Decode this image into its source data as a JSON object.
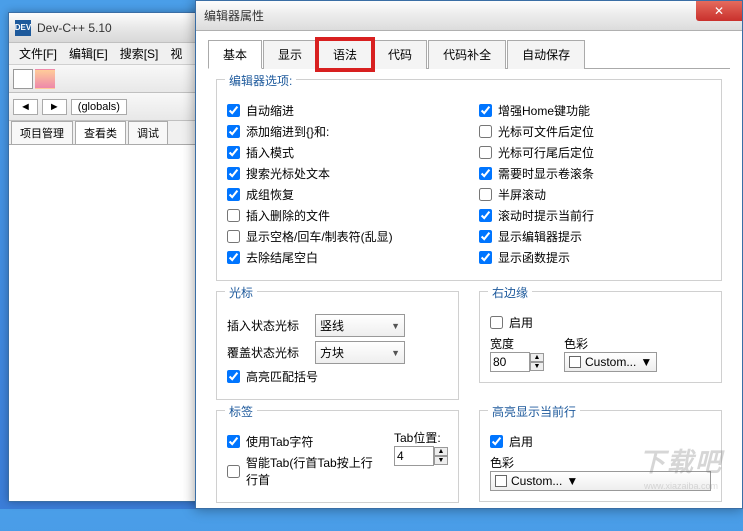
{
  "main": {
    "title": "Dev-C++ 5.10",
    "icon_text": "DEV",
    "menu": [
      "文件[F]",
      "编辑[E]",
      "搜索[S]",
      "视"
    ],
    "globals": "(globals)",
    "proj_tabs": [
      "项目管理",
      "查看类",
      "调试"
    ]
  },
  "dialog": {
    "title": "编辑器属性",
    "tabs": [
      "基本",
      "显示",
      "语法",
      "代码",
      "代码补全",
      "自动保存"
    ],
    "highlighted_tab_index": 2,
    "active_tab_index": 0,
    "editor_options_title": "编辑器选项:",
    "left_checks": [
      {
        "label": "自动缩进",
        "checked": true
      },
      {
        "label": "添加缩进到{}和:",
        "checked": true
      },
      {
        "label": "插入模式",
        "checked": true
      },
      {
        "label": "搜索光标处文本",
        "checked": true
      },
      {
        "label": "成组恢复",
        "checked": true
      },
      {
        "label": "插入删除的文件",
        "checked": false
      },
      {
        "label": "显示空格/回车/制表符(乱显)",
        "checked": false
      },
      {
        "label": "去除结尾空白",
        "checked": true
      }
    ],
    "right_checks": [
      {
        "label": "增强Home键功能",
        "checked": true
      },
      {
        "label": "光标可文件后定位",
        "checked": false
      },
      {
        "label": "光标可行尾后定位",
        "checked": false
      },
      {
        "label": "需要时显示卷滚条",
        "checked": true
      },
      {
        "label": "半屏滚动",
        "checked": false
      },
      {
        "label": "滚动时提示当前行",
        "checked": true
      },
      {
        "label": "显示编辑器提示",
        "checked": true
      },
      {
        "label": "显示函数提示",
        "checked": true
      }
    ],
    "cursor": {
      "title": "光标",
      "insert_label": "插入状态光标",
      "insert_value": "竖线",
      "overwrite_label": "覆盖状态光标",
      "overwrite_value": "方块",
      "highlight_bracket": {
        "label": "高亮匹配括号",
        "checked": true
      }
    },
    "right_margin": {
      "title": "右边缘",
      "enable": {
        "label": "启用",
        "checked": false
      },
      "width_label": "宽度",
      "width_value": "80",
      "color_label": "色彩",
      "color_value": "Custom..."
    },
    "tabs_group": {
      "title": "标签",
      "use_tab": {
        "label": "使用Tab字符",
        "checked": true
      },
      "smart_tab": {
        "label": "智能Tab(行首Tab按上行行首",
        "checked": false
      },
      "tab_pos_label": "Tab位置:",
      "tab_pos_value": "4"
    },
    "highlight_line": {
      "title": "高亮显示当前行",
      "enable": {
        "label": "启用",
        "checked": true
      },
      "color_label": "色彩",
      "color_value": "Custom..."
    }
  },
  "watermark": "下载吧",
  "watermark_sub": "www.xiazaiba.com"
}
